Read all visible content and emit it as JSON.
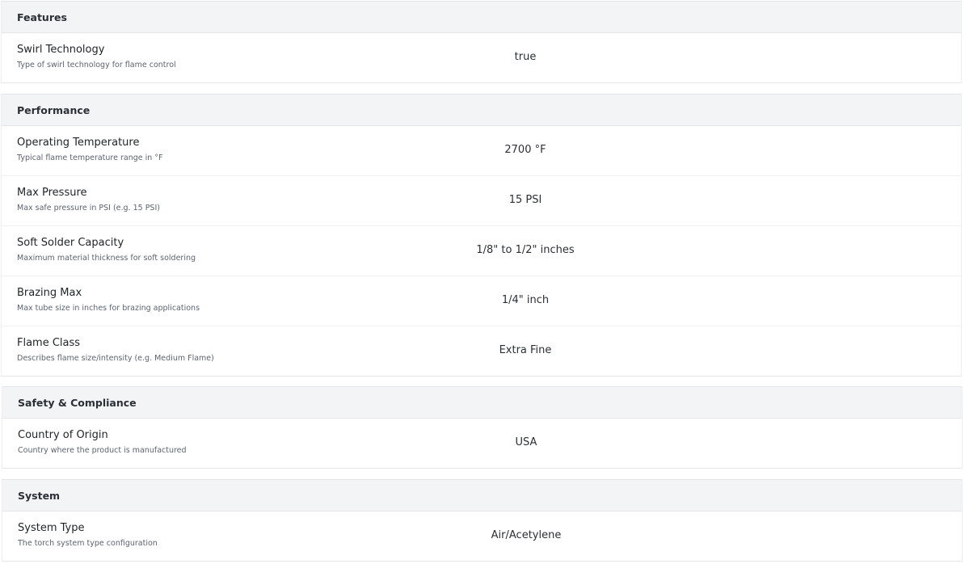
{
  "sections": [
    {
      "title": "Features",
      "rows": [
        {
          "label": "Swirl Technology",
          "description": "Type of swirl technology for flame control",
          "value": "true"
        }
      ]
    },
    {
      "title": "Performance",
      "rows": [
        {
          "label": "Operating Temperature",
          "description": "Typical flame temperature range in °F",
          "value": "2700 °F"
        },
        {
          "label": "Max Pressure",
          "description": "Max safe pressure in PSI (e.g. 15 PSI)",
          "value": "15 PSI"
        },
        {
          "label": "Soft Solder Capacity",
          "description": "Maximum material thickness for soft soldering",
          "value": "1/8\" to 1/2\" inches"
        },
        {
          "label": "Brazing Max",
          "description": "Max tube size in inches for brazing applications",
          "value": "1/4\" inch"
        },
        {
          "label": "Flame Class",
          "description": "Describes flame size/intensity (e.g. Medium Flame)",
          "value": "Extra Fine"
        }
      ]
    },
    {
      "title": "Safety & Compliance",
      "rows": [
        {
          "label": "Country of Origin",
          "description": "Country where the product is manufactured",
          "value": "USA"
        }
      ]
    },
    {
      "title": "System",
      "rows": [
        {
          "label": "System Type",
          "description": "The torch system type configuration",
          "value": "Air/Acetylene"
        }
      ]
    }
  ]
}
